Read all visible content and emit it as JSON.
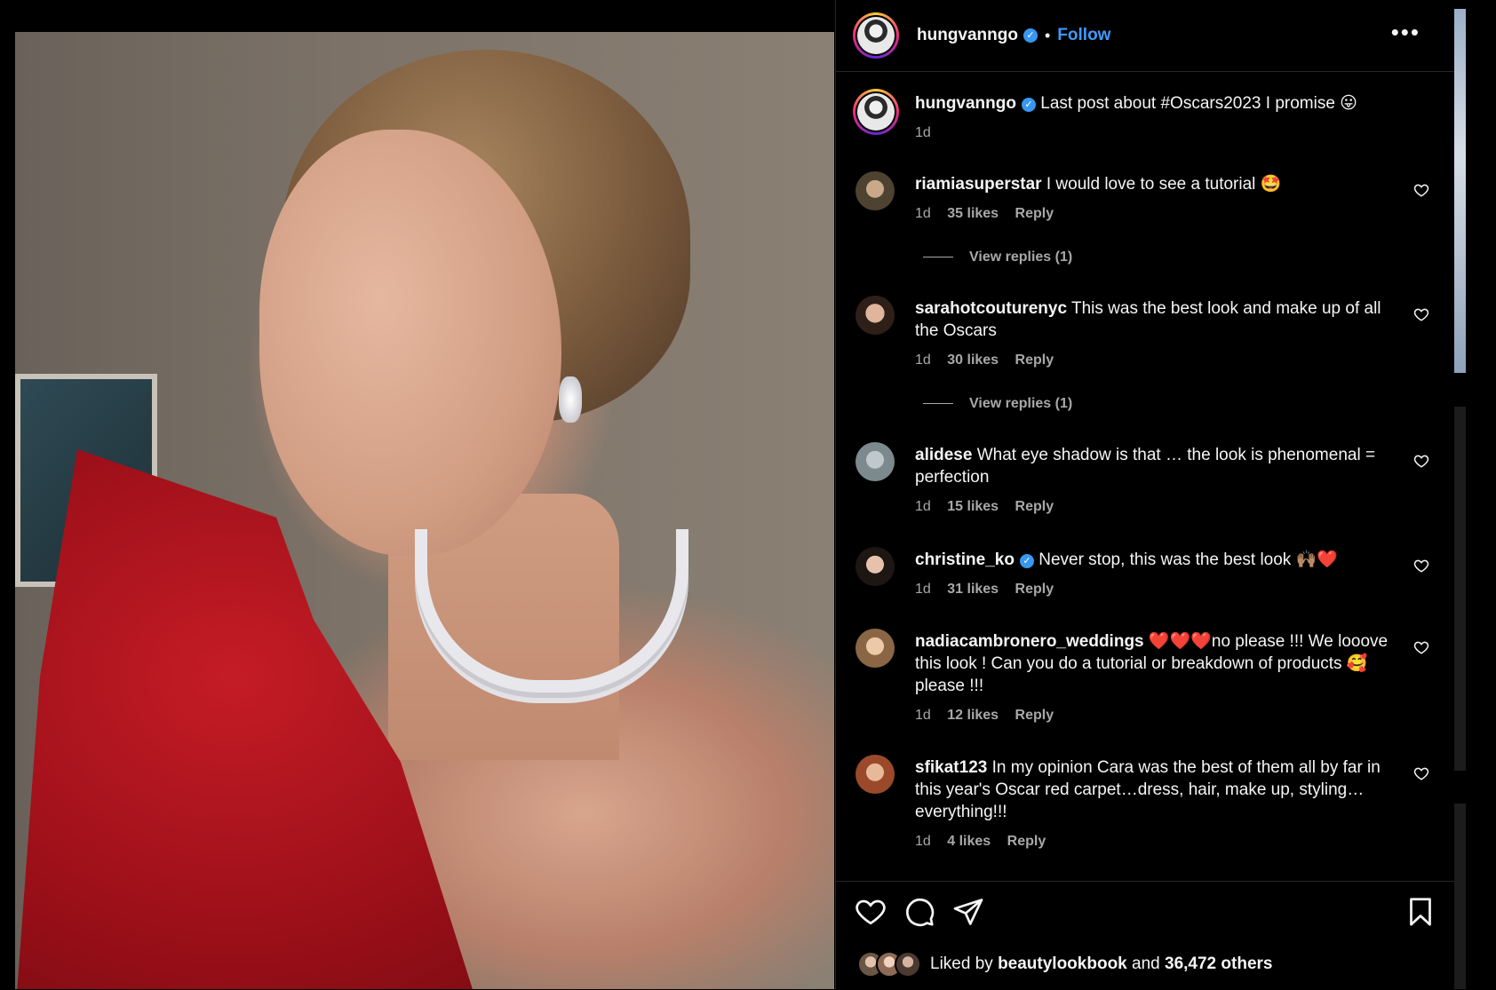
{
  "post": {
    "username": "hungvanngo",
    "follow_label": "Follow",
    "more_label": "•••",
    "caption_text": "Last post about #Oscars2023 I promise 😛",
    "caption_time": "1d"
  },
  "comments": [
    {
      "user": "riamiasuperstar",
      "text": "I would love to see a tutorial 🤩",
      "time": "1d",
      "likes": "35 likes",
      "reply": "Reply",
      "replies": "View replies (1)"
    },
    {
      "user": "sarahotcouturenyc",
      "text": "This was the best look and make up of all the Oscars",
      "time": "1d",
      "likes": "30 likes",
      "reply": "Reply",
      "replies": "View replies (1)"
    },
    {
      "user": "alidese",
      "text": "What eye shadow is that … the look is phenomenal = perfection",
      "time": "1d",
      "likes": "15 likes",
      "reply": "Reply"
    },
    {
      "user": "christine_ko",
      "text": "Never stop, this was the best look 🙌🏽❤️",
      "time": "1d",
      "likes": "31 likes",
      "reply": "Reply"
    },
    {
      "user": "nadiacambronero_weddings",
      "text": "❤️❤️❤️no please !!! We looove this look ! Can you do a tutorial or breakdown of products 🥰 please !!!",
      "time": "1d",
      "likes": "12 likes",
      "reply": "Reply"
    },
    {
      "user": "sfikat123",
      "text": "In my opinion Cara was the best of them all by far in this year's Oscar red carpet…dress, hair, make up, styling… everything!!!",
      "time": "1d",
      "likes": "4 likes",
      "reply": "Reply"
    }
  ],
  "footer": {
    "liked_prefix": "Liked by",
    "liked_user": "beautylookbook",
    "liked_and": "and",
    "liked_count": "36,472 others"
  },
  "colors": {
    "accent": "#3d9bff",
    "background": "#000000",
    "muted_text": "#a8a8a8"
  }
}
